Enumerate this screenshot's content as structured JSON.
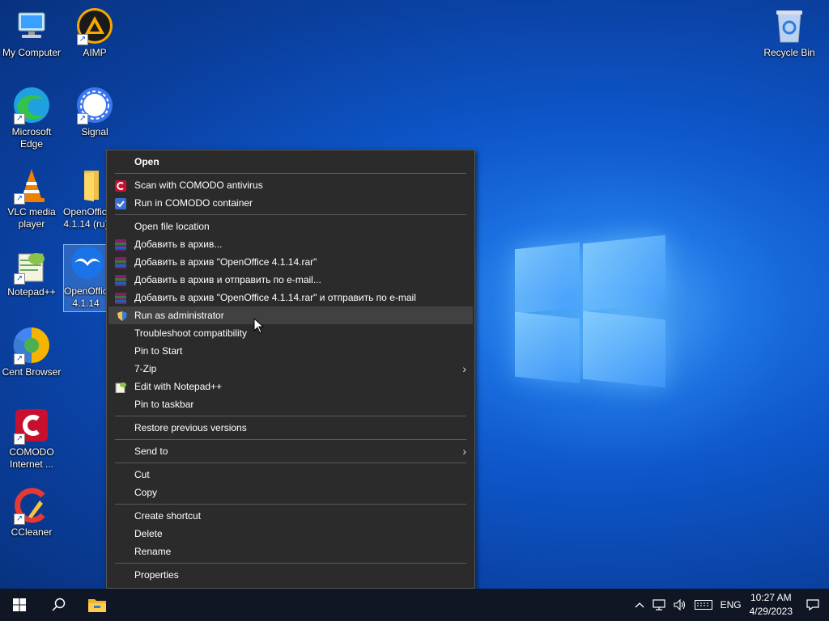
{
  "desktop": {
    "icons": [
      {
        "label": "My Computer"
      },
      {
        "label": "AIMP"
      },
      {
        "label": "Microsoft Edge"
      },
      {
        "label": "Signal"
      },
      {
        "label": "VLC media player"
      },
      {
        "label": "OpenOffice 4.1.14 (ru)"
      },
      {
        "label": "Notepad++"
      },
      {
        "label": "OpenOffice 4.1.14"
      },
      {
        "label": "Cent Browser"
      },
      {
        "label": "COMODO Internet ..."
      },
      {
        "label": "CCleaner"
      },
      {
        "label": "Recycle Bin"
      }
    ]
  },
  "context_menu": {
    "open": "Open",
    "scan_comodo": "Scan with COMODO antivirus",
    "run_comodo_container": "Run in COMODO container",
    "open_file_location": "Open file location",
    "add_archive": "Добавить в архив...",
    "add_archive_rar": "Добавить в архив \"OpenOffice 4.1.14.rar\"",
    "add_archive_email": "Добавить в архив и отправить по e-mail...",
    "add_archive_rar_email": "Добавить в архив \"OpenOffice 4.1.14.rar\" и отправить по e-mail",
    "run_as_admin": "Run as administrator",
    "troubleshoot": "Troubleshoot compatibility",
    "pin_start": "Pin to Start",
    "seven_zip": "7-Zip",
    "edit_notepad": "Edit with Notepad++",
    "pin_taskbar": "Pin to taskbar",
    "restore_versions": "Restore previous versions",
    "send_to": "Send to",
    "cut": "Cut",
    "copy": "Copy",
    "create_shortcut": "Create shortcut",
    "delete": "Delete",
    "rename": "Rename",
    "properties": "Properties"
  },
  "taskbar": {
    "language": "ENG",
    "time": "10:27 AM",
    "date": "4/29/2023"
  },
  "colors": {
    "menu_bg": "#2b2b2b",
    "menu_hover": "#414141",
    "taskbar_bg": "#101624",
    "desktop_blue": "#0d55c8"
  }
}
